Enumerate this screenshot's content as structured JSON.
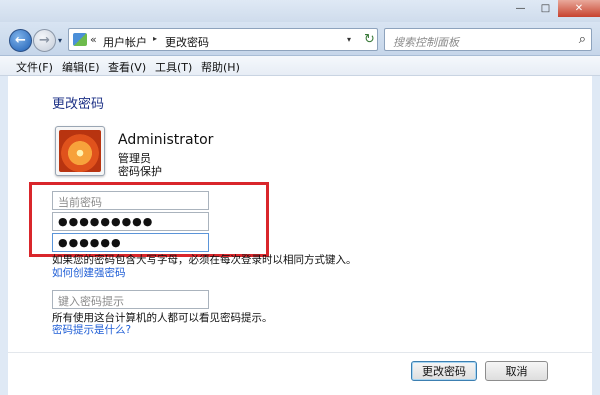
{
  "window": {
    "min_glyph": "—",
    "max_glyph": "□",
    "close_glyph": "✕"
  },
  "navigation": {
    "back_glyph": "←",
    "forward_glyph": "→",
    "history_glyph": "▾",
    "breadcrumb_prefix": "«",
    "breadcrumbs": [
      "用户帐户",
      "更改密码"
    ],
    "crumb_arrow": "▸",
    "dropdown_glyph": "▾",
    "refresh_glyph": "↻",
    "search_placeholder": "搜索控制面板",
    "search_glyph": "⌕"
  },
  "menu": {
    "items": [
      "文件(F)",
      "编辑(E)",
      "查看(V)",
      "工具(T)",
      "帮助(H)"
    ]
  },
  "page": {
    "title": "更改密码",
    "user": {
      "name": "Administrator",
      "role": "管理员",
      "protection": "密码保护"
    },
    "fields": {
      "current_placeholder": "当前密码",
      "new_value": "●●●●●●●●●",
      "confirm_value": "●●●●●●",
      "hint_placeholder": "键入密码提示"
    },
    "case_note": "如果您的密码包含大写字母，必须在每次登录时以相同方式键入。",
    "strong_password_link": "如何创建强密码",
    "hint_note": "所有使用这台计算机的人都可以看见密码提示。",
    "hint_link": "密码提示是什么?"
  },
  "buttons": {
    "change": "更改密码",
    "cancel": "取消"
  },
  "colors": {
    "highlight": "#d9262b",
    "link": "#1f5ed6",
    "title": "#1e3287"
  }
}
